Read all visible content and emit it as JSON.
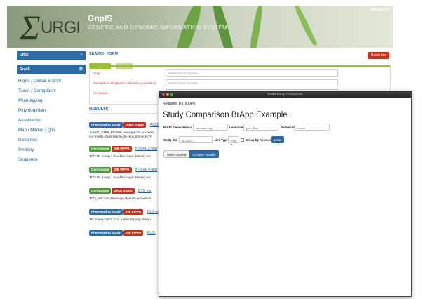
{
  "gnpis": {
    "banner": {
      "logo_initial": "Σ",
      "logo_rest": "URGI",
      "title": "GnpIS",
      "subtitle": "GENETIC AND GENOMIC INFORMATION SYSTEM",
      "feedback": "FEEDBACK"
    },
    "nav": {
      "urgi_label": "URGI",
      "gnpis_label": "GnpIS",
      "links": [
        "Home / Global Search",
        "Taxon / Germplasm",
        "Phenotyping",
        "Polymorphism",
        "Association",
        "Map / Marker / QTL",
        "Genomes",
        "Synteny",
        "Sequence"
      ]
    },
    "search": {
      "title": "SEARCH FORM",
      "reset": "Reset tab",
      "tabs": [
        "Germplasm",
        "Variable"
      ],
      "rows": [
        {
          "label": "Crop",
          "placeholder": "Select Some Options"
        },
        {
          "label": "Germplasm list (panel, collection, population)",
          "placeholder": "Select Some Options"
        },
        {
          "label": "Accession",
          "placeholder": ""
        }
      ]
    },
    "results": {
      "title": "RESULTS",
      "items": [
        {
          "badges": [
            "Phenotyping Study",
            "URGI GnpIS"
          ],
          "link": "ASSO",
          "desc": "\"ASSO_S1P9_FFUW6_Average:Gif-sur-Yvett sur-Yvette,Saint-Martin-de-Hinx,Embeck (Fr"
        },
        {
          "badges": [
            "Germplasm",
            "VIB PIPPA"
          ],
          "link": "B73 RL 2-way",
          "desc": "\"B73 RL 2-way \" is a Zea mays (Maize) acc"
        },
        {
          "badges": [
            "Germplasm",
            "VIB PIPPA"
          ],
          "link": "B73 RL 4-way",
          "desc": "\"B73 RL 4-way \" is a Zea mays (Maize) acc"
        },
        {
          "badges": [
            "Germplasm",
            "URGI GnpIS"
          ],
          "link": "B73_ms",
          "desc": "\"B73_ms\" is a Zea mays (Maize) accession"
        },
        {
          "badges": [
            "Phenotyping Study",
            "VIB PIPPA"
          ],
          "link": "RL 2-w",
          "desc": "\"RL 2-way batch 1\" is a phenotyping study i"
        },
        {
          "badges": [
            "Phenotyping Study",
            "VIB PIPPA"
          ],
          "link": "RL 2-",
          "desc": ""
        }
      ]
    }
  },
  "brapp": {
    "window_title": "BrAPI Study Comparison",
    "requires": "Requires: D3, jQuery",
    "title": "Study Comparison BrApp Example",
    "fields": {
      "server_label": "BrAPI Server Admin:",
      "server_value": "yambase.org",
      "username_label": "Username:",
      "username_value": "john_Doe",
      "password_label": "Password:",
      "password_value": "••••••••",
      "study_label": "Study IDs:",
      "study_value": "16,20,21",
      "unit_label": "Unit Type:",
      "unit_value": "Plot",
      "group_label": "Group By Accession:",
      "load": "Load"
    },
    "buttons": {
      "select_variable": "Select Variable",
      "compare": "Compare Variable"
    }
  }
}
